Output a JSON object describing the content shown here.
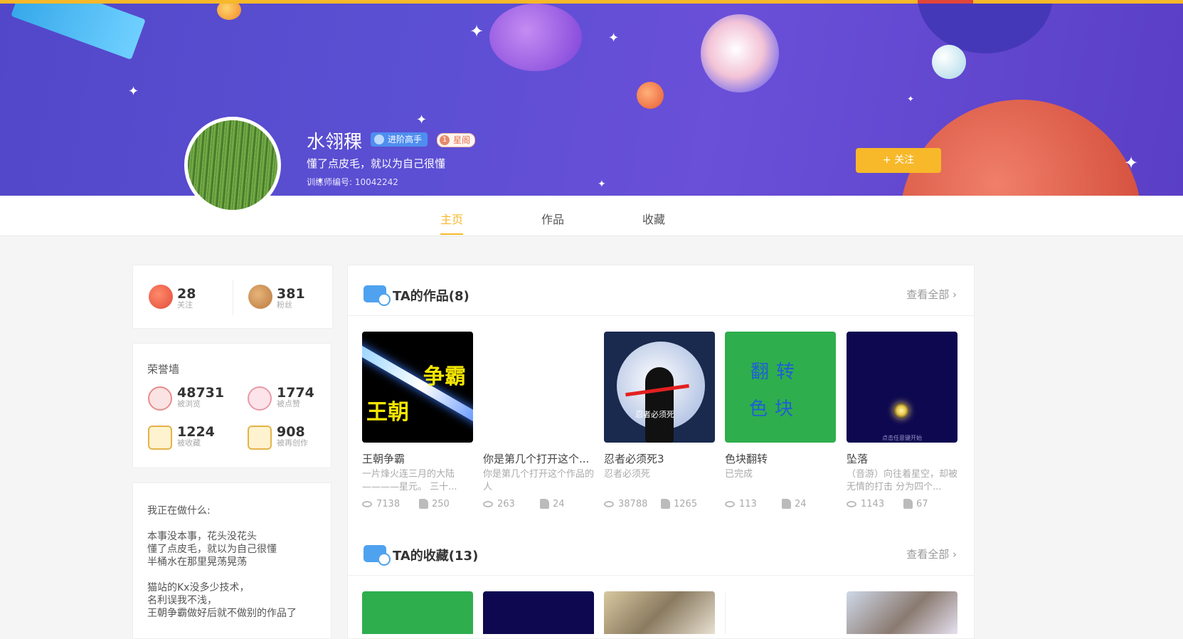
{
  "profile": {
    "username": "水翎稞",
    "badge_level": "进阶高手",
    "badge_star": "星阁",
    "badge_star_num": "1",
    "motto": "懂了点皮毛，就以为自己很懂",
    "trainer_id": "训练师编号: 10042242",
    "follow_button": "+ 关注"
  },
  "tabs": [
    {
      "label": "主页",
      "active": true
    },
    {
      "label": "作品",
      "active": false
    },
    {
      "label": "收藏",
      "active": false
    }
  ],
  "follow_stats": {
    "following": {
      "value": "28",
      "label": "关注"
    },
    "fans": {
      "value": "381",
      "label": "粉丝"
    }
  },
  "honor": {
    "title": "荣誉墙",
    "items": [
      {
        "value": "48731",
        "label": "被浏览",
        "icon": "eye-icon"
      },
      {
        "value": "1774",
        "label": "被点赞",
        "icon": "like-hand-icon"
      },
      {
        "value": "1224",
        "label": "被收藏",
        "icon": "star-box-icon"
      },
      {
        "value": "908",
        "label": "被再创作",
        "icon": "edit-card-icon"
      }
    ]
  },
  "doing": {
    "title": "我正在做什么:",
    "lines": [
      "本事没本事，花头没花头",
      "懂了点皮毛，就以为自己很懂",
      "半桶水在那里晃荡晃荡",
      "",
      "猫站的Kx没多少技术，",
      "名利误我不浅，",
      "王朝争霸做好后就不做别的作品了"
    ]
  },
  "works": {
    "title": "TA的作品(8)",
    "view_all": "查看全部",
    "items": [
      {
        "title": "王朝争霸",
        "desc": "一片烽火连三月的大陆————星元。 三十...",
        "views": "7138",
        "likes": "250",
        "thumb_text_a": "争霸",
        "thumb_text_b": "王朝"
      },
      {
        "title": "你是第几个打开这个...",
        "desc": "你是第几个打开这个作品的人",
        "views": "263",
        "likes": "24"
      },
      {
        "title": "忍者必须死3",
        "desc": "忍者必须死",
        "views": "38788",
        "likes": "1265",
        "thumb_text_a": "忍者必须死"
      },
      {
        "title": "色块翻转",
        "desc": "已完成",
        "views": "113",
        "likes": "24",
        "thumb_text_a": "翻转",
        "thumb_text_b": "色块"
      },
      {
        "title": "坠落",
        "desc": "（音游）向往着星空，却被无情的打击 分为四个...",
        "views": "1143",
        "likes": "67",
        "thumb_text_a": "点击任意键开始"
      }
    ]
  },
  "collections": {
    "title": "TA的收藏(13)",
    "view_all": "查看全部"
  },
  "colors": {
    "accent": "#f7b829",
    "banner": "#5b4fd3",
    "blue": "#4fa2ef"
  }
}
